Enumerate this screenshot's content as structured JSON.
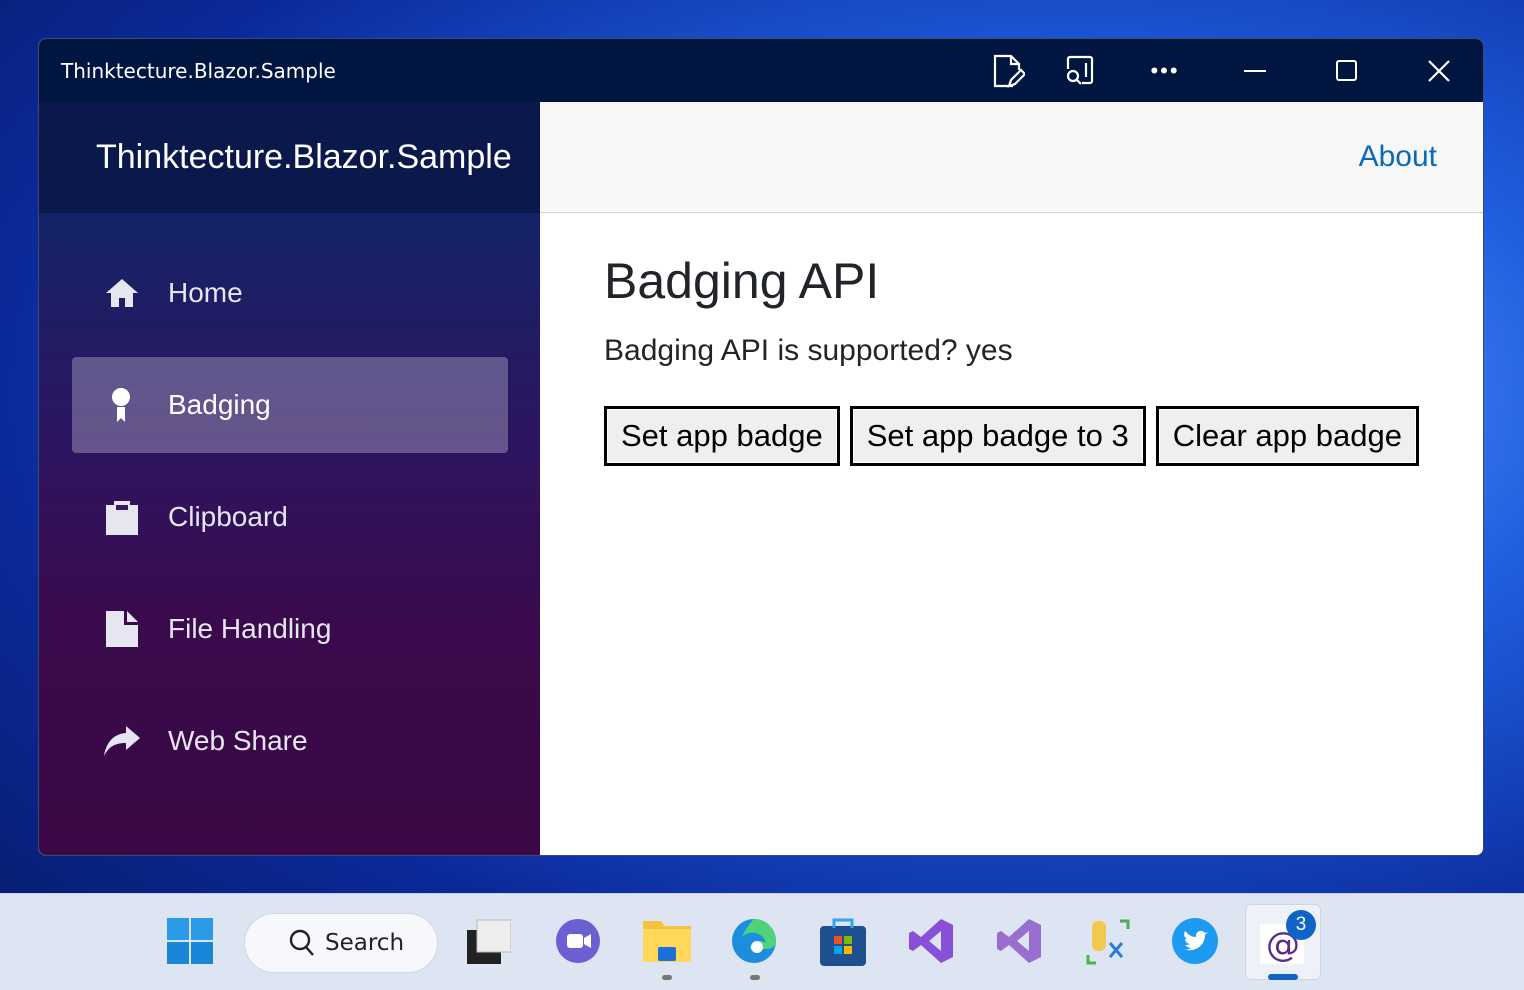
{
  "window": {
    "title": "Thinktecture.Blazor.Sample"
  },
  "sidebar": {
    "brand": "Thinktecture.Blazor.Sample",
    "items": [
      {
        "label": "Home",
        "icon": "home-icon"
      },
      {
        "label": "Badging",
        "icon": "badge-icon",
        "active": true
      },
      {
        "label": "Clipboard",
        "icon": "clipboard-icon"
      },
      {
        "label": "File Handling",
        "icon": "file-icon"
      },
      {
        "label": "Web Share",
        "icon": "share-icon"
      }
    ]
  },
  "topbar": {
    "about": "About"
  },
  "main": {
    "title": "Badging API",
    "supported_text": "Badging API is supported? yes",
    "buttons": [
      "Set app badge",
      "Set app badge to 3",
      "Clear app badge"
    ]
  },
  "taskbar": {
    "search": "Search",
    "badge_count": "3"
  },
  "colors": {
    "titlebar": "#001640",
    "accent": "#0a6ab8"
  }
}
